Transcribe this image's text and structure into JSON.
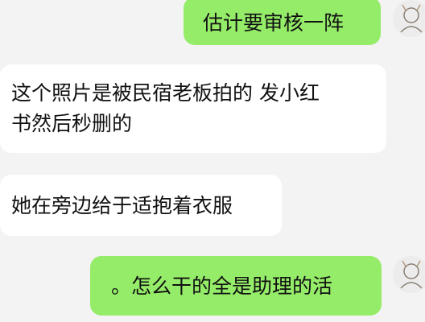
{
  "chat": {
    "messages": [
      {
        "side": "sent",
        "text": "估计要审核一阵"
      },
      {
        "side": "received",
        "line1": "这个照片是被民宿老板拍的 发小红",
        "line2": "书然后秒删的"
      },
      {
        "side": "received",
        "text": "她在旁边给于适抱着衣服"
      },
      {
        "side": "sent",
        "text": "。怎么干的全是助理的活"
      }
    ],
    "avatar_icon": "user-avatar-sketch-icon"
  },
  "colors": {
    "background": "#f3f3f3",
    "sent_bubble": "#95ec69",
    "received_bubble": "#ffffff"
  }
}
